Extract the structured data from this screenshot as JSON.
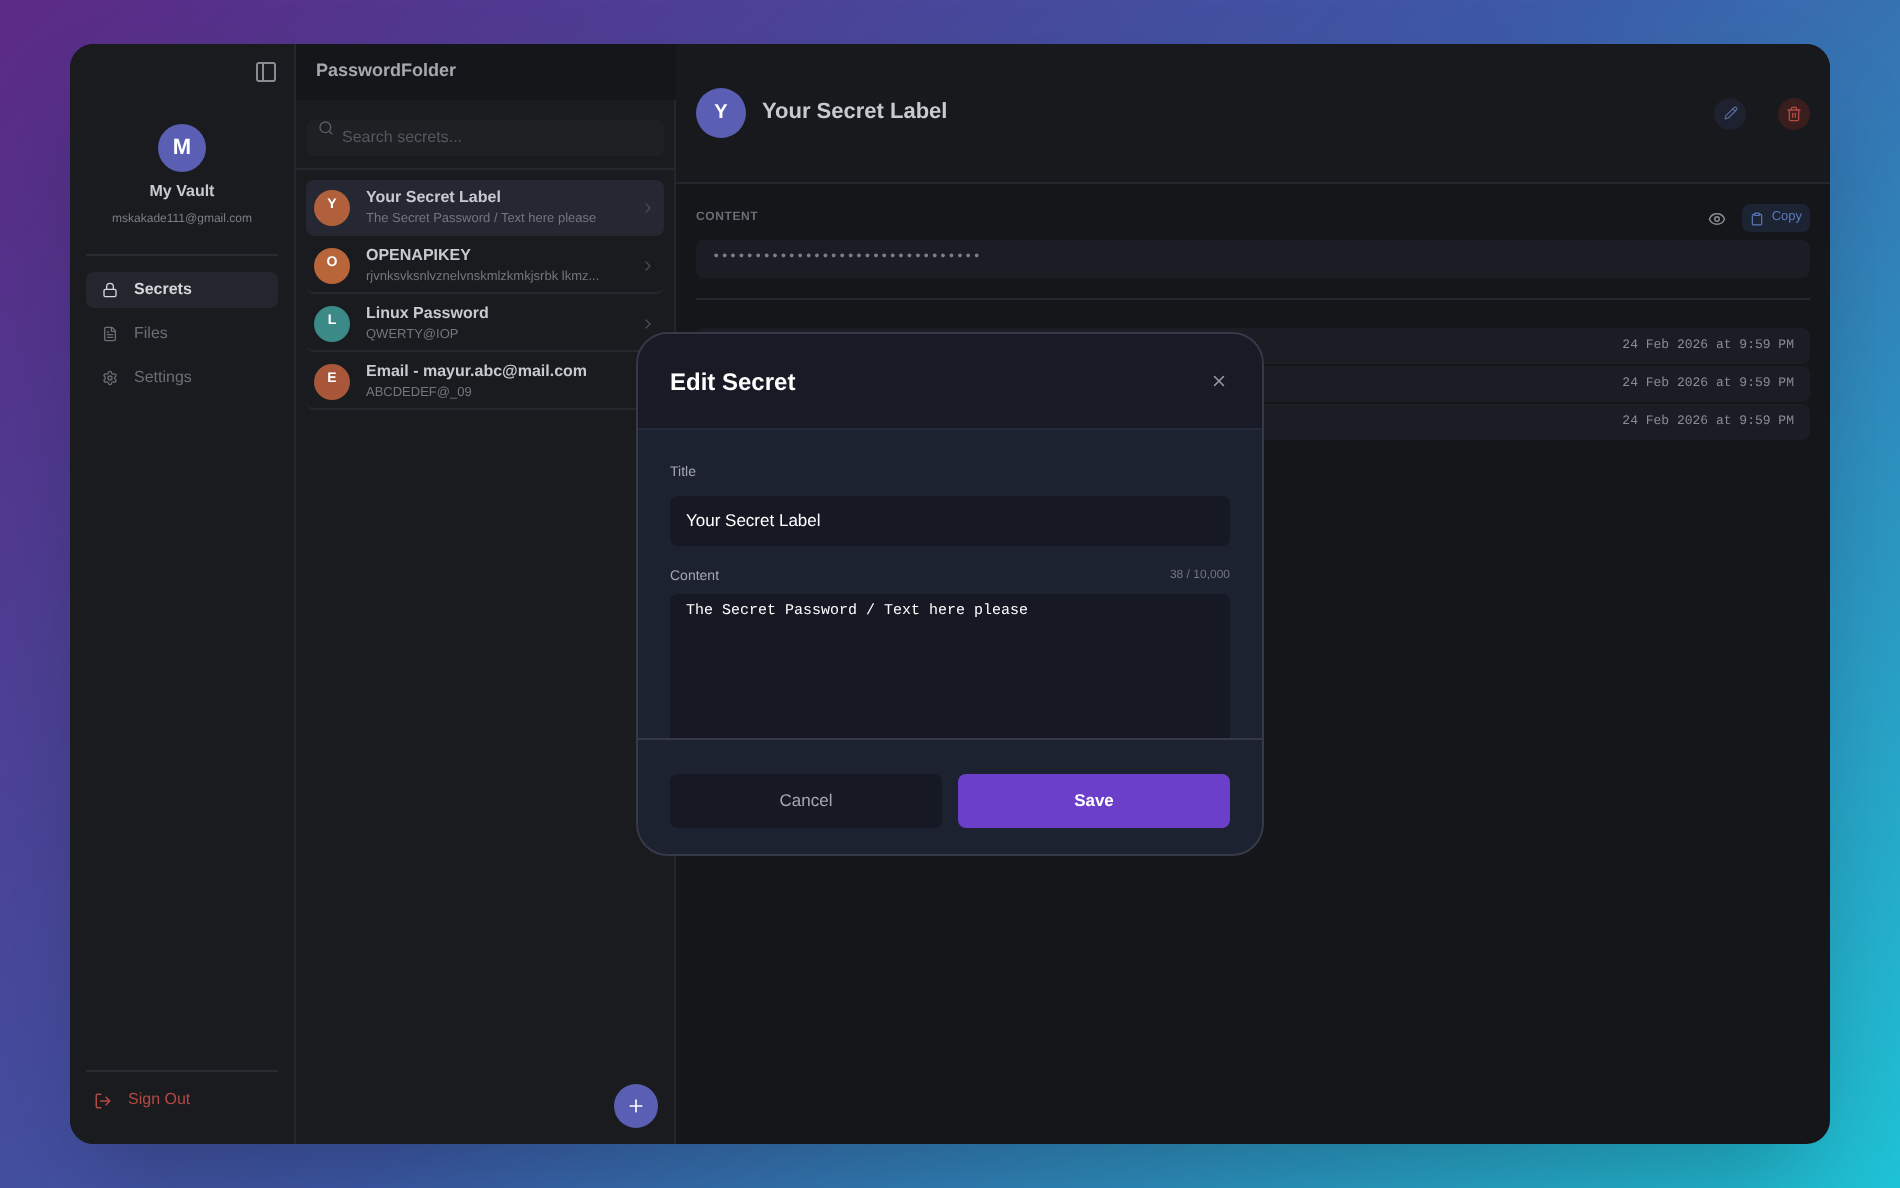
{
  "app": {
    "title": "PasswordFolder"
  },
  "profile": {
    "initial": "M",
    "name": "My Vault",
    "email": "mskakade111@gmail.com"
  },
  "nav": [
    {
      "label": "Secrets",
      "selected": true
    },
    {
      "label": "Files",
      "selected": false
    },
    {
      "label": "Settings",
      "selected": false
    }
  ],
  "sign_out": "Sign Out",
  "search": {
    "placeholder": "Search secrets..."
  },
  "secrets": [
    {
      "initial": "Y",
      "title": "Your Secret Label",
      "preview": "The Secret Password / Text here please",
      "color": "#b0603a",
      "selected": true
    },
    {
      "initial": "O",
      "title": "OPENAPIKEY",
      "preview": "rjvnksvksnlvznelvnskmlzkmkjsrbk lkmz...",
      "color": "#b8653a",
      "selected": false
    },
    {
      "initial": "L",
      "title": "Linux Password",
      "preview": "QWERTY@IOP",
      "color": "#3c8a88",
      "selected": false
    },
    {
      "initial": "E",
      "title": "Email - mayur.abc@mail.com",
      "preview": "ABCDEDEF@_09",
      "color": "#a8573a",
      "selected": false
    }
  ],
  "detail": {
    "initial": "Y",
    "title": "Your Secret Label",
    "content_label": "CONTENT",
    "copy": "Copy",
    "masked": "••••••••••••••••••••••••••••••••",
    "history": [
      "24 Feb 2026 at 9:59 PM",
      "24 Feb 2026 at 9:59 PM",
      "24 Feb 2026 at 9:59 PM"
    ]
  },
  "dialog": {
    "title": "Edit Secret",
    "title_label": "Title",
    "title_value": "Your Secret Label",
    "content_label": "Content",
    "counter": "38 / 10,000",
    "content_value": "The Secret Password / Text here please",
    "cancel": "Cancel",
    "save": "Save"
  }
}
